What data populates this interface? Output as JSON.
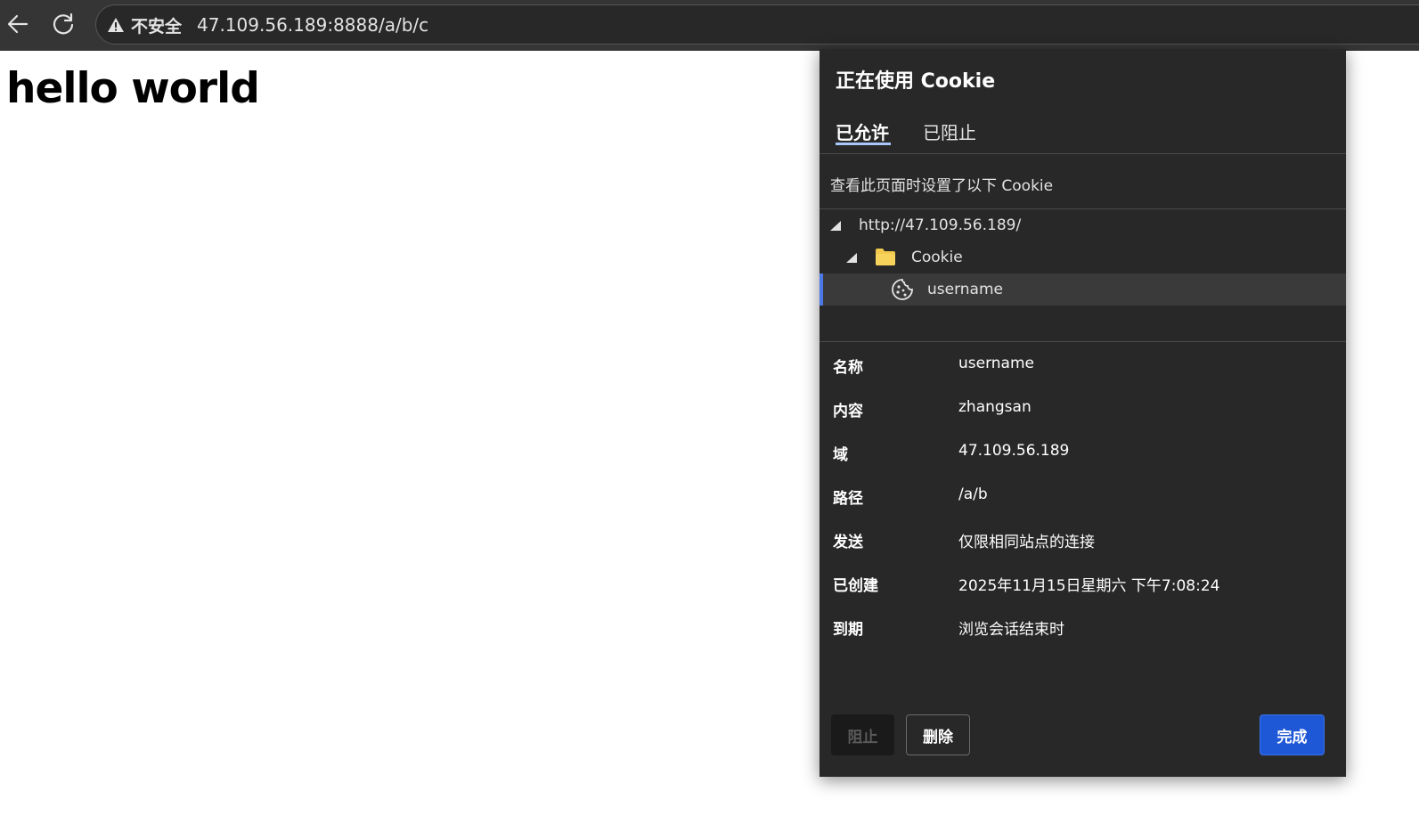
{
  "toolbar": {
    "back_icon": "arrow-left-icon",
    "reload_icon": "reload-icon",
    "security_icon": "warning-triangle-icon",
    "security_label": "不安全",
    "url": "47.109.56.189:8888/a/b/c"
  },
  "page": {
    "heading": "hello world"
  },
  "cookie_popup": {
    "title": "正在使用 Cookie",
    "tabs": {
      "allowed": "已允许",
      "blocked": "已阻止",
      "active": "allowed"
    },
    "description": "查看此页面时设置了以下 Cookie",
    "tree": {
      "site": "http://47.109.56.189/",
      "folder": "Cookie",
      "folder_icon": "folder-icon",
      "cookie": "username",
      "cookie_icon": "cookie-icon"
    },
    "details": {
      "name": {
        "label": "名称",
        "value": "username"
      },
      "content": {
        "label": "内容",
        "value": "zhangsan"
      },
      "domain": {
        "label": "域",
        "value": "47.109.56.189"
      },
      "path": {
        "label": "路径",
        "value": "/a/b"
      },
      "send": {
        "label": "发送",
        "value": "仅限相同站点的连接"
      },
      "created": {
        "label": "已创建",
        "value": "2025年11月15日星期六 下午7:08:24"
      },
      "expires": {
        "label": "到期",
        "value": "浏览会话结束时"
      }
    },
    "buttons": {
      "block": "阻止",
      "delete": "删除",
      "done": "完成"
    },
    "colors": {
      "background": "#282828",
      "accent": "#1f58d6",
      "tab_underline": "#a8c7fa",
      "selection_bar": "#4a78e6"
    }
  }
}
